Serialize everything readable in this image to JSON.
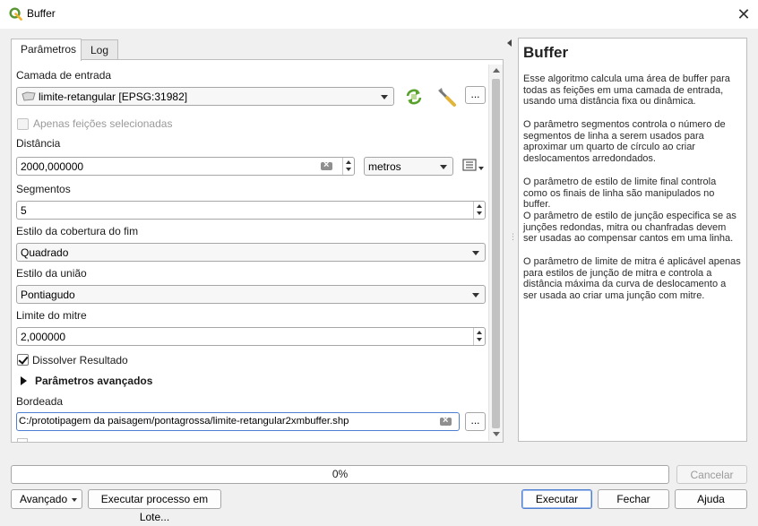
{
  "window": {
    "title": "Buffer"
  },
  "tabs": [
    {
      "label": "Parâmetros",
      "active": true
    },
    {
      "label": "Log",
      "active": false
    }
  ],
  "params": {
    "input_layer": {
      "label": "Camada de entrada",
      "value": "limite-retangular [EPSG:31982]",
      "more_button": "..."
    },
    "selected_only": {
      "label": "Apenas feições selecionadas",
      "checked": false,
      "enabled": false
    },
    "distance": {
      "label": "Distância",
      "value": "2000,000000",
      "unit": "metros"
    },
    "segments": {
      "label": "Segmentos",
      "value": "5"
    },
    "end_cap": {
      "label": "Estilo da cobertura do fim",
      "value": "Quadrado"
    },
    "join_style": {
      "label": "Estilo da união",
      "value": "Pontiagudo"
    },
    "miter_limit": {
      "label": "Limite do mitre",
      "value": "2,000000"
    },
    "dissolve": {
      "label": "Dissolver Resultado",
      "checked": true
    },
    "advanced": {
      "label": "Parâmetros avançados"
    },
    "output": {
      "label": "Bordeada",
      "value": "C:/prototipagem da paisagem/pontagrossa/limite-retangular2xmbuffer.shp",
      "more_button": "..."
    }
  },
  "help": {
    "title": "Buffer",
    "paragraphs": [
      "Esse algoritmo calcula uma área de buffer para todas as feições em uma camada de entrada, usando uma distância fixa ou dinâmica.",
      "O parâmetro segmentos controla o número de segmentos de linha a serem usados para aproximar um quarto de círculo ao criar deslocamentos arredondados.",
      "O parâmetro de estilo de limite final controla como os finais de linha são manipulados no buffer.",
      "O parâmetro de estilo de junção especifica se as junções redondas, mitra ou chanfradas devem ser usadas ao compensar cantos em uma linha.",
      "O parâmetro de limite de mitra é aplicável apenas para estilos de junção de mitra e controla a distância máxima da curva de deslocamento a ser usada ao criar uma junção com mitre."
    ]
  },
  "progress": {
    "percent": 0,
    "label": "0%"
  },
  "buttons": {
    "cancel": "Cancelar",
    "advanced": "Avançado",
    "batch": "Executar processo em Lote...",
    "run": "Executar",
    "close": "Fechar",
    "help": "Ajuda"
  },
  "colors": {
    "qgis_green": "#589632",
    "accent_blue": "#4f7fd0"
  }
}
